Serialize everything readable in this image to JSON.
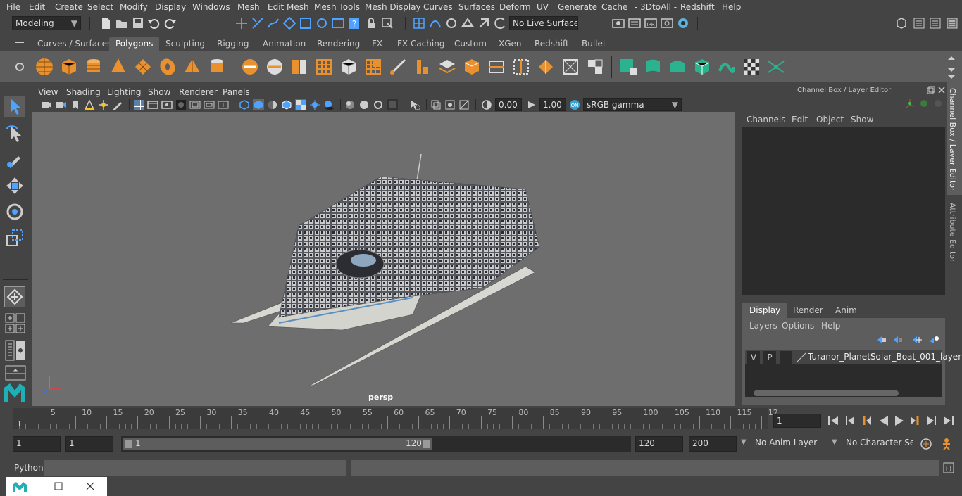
{
  "menu": [
    "File",
    "Edit",
    "Create",
    "Select",
    "Modify",
    "Display",
    "Windows",
    "Mesh",
    "Edit Mesh",
    "Mesh Tools",
    "Mesh Display",
    "Curves",
    "Surfaces",
    "Deform",
    "UV",
    "Generate",
    "Cache",
    "- 3DtoAll -",
    "Redshift",
    "Help"
  ],
  "status": {
    "mode": "Modeling",
    "live_surface": "No Live Surface"
  },
  "shelf_tabs": [
    "Curves / Surfaces",
    "Polygons",
    "Sculpting",
    "Rigging",
    "Animation",
    "Rendering",
    "FX",
    "FX Caching",
    "Custom",
    "XGen",
    "Redshift",
    "Bullet"
  ],
  "active_shelf": "Polygons",
  "viewport": {
    "menu": [
      "View",
      "Shading",
      "Lighting",
      "Show",
      "Renderer",
      "Panels"
    ],
    "exposure": "0.00",
    "gamma": "1.00",
    "colorspace": "sRGB gamma",
    "camera": "persp"
  },
  "channel_box": {
    "title": "Channel Box / Layer Editor",
    "menu": [
      "Channels",
      "Edit",
      "Object",
      "Show"
    ],
    "layer_tabs": [
      "Display",
      "Render",
      "Anim"
    ],
    "active_layer_tab": "Display",
    "layer_menu": [
      "Layers",
      "Options",
      "Help"
    ],
    "layer": {
      "v": "V",
      "p": "P",
      "name": "Turanor_PlanetSolar_Boat_001_layer"
    }
  },
  "side_tabs": {
    "channel": "Channel Box / Layer Editor",
    "attr": "Attribute Editor"
  },
  "timeline": {
    "labels": [
      "5",
      "10",
      "15",
      "20",
      "25",
      "30",
      "35",
      "40",
      "45",
      "50",
      "55",
      "60",
      "65",
      "70",
      "75",
      "80",
      "85",
      "90",
      "95",
      "100",
      "105",
      "110",
      "115",
      "12"
    ],
    "start_marker": "1",
    "current_frame": "1"
  },
  "range": {
    "start": "1",
    "start2": "1",
    "slider_start": "1",
    "slider_end": "120",
    "end": "120",
    "end2": "200",
    "anim_layer": "No Anim Layer",
    "char_set": "No Character Set"
  },
  "command": {
    "label": "Python"
  }
}
